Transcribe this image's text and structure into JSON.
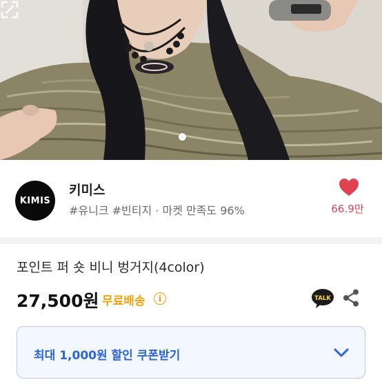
{
  "photo": {
    "image_desc_icon": "product-photo",
    "pager_dot_icon": "pager-dot",
    "expand_icon": "expand-icon"
  },
  "seller": {
    "logo_text": "KIMIS",
    "name": "키미스",
    "tags": "#유니크 #빈티지 · 마켓 만족도 96%",
    "likes": "66.9만",
    "heart_color": "#e0424f"
  },
  "product": {
    "title": "포인트 퍼 숏 비니 벙거지(4color)",
    "price": "27,500원",
    "shipping": "무료배송",
    "shipping_color": "#f0a30a",
    "info_icon_glyph": "i",
    "talk_icon_text": "TALK"
  },
  "coupon": {
    "label": "최대 1,000원 할인 쿠폰받기",
    "accent": "#2a64d8"
  }
}
